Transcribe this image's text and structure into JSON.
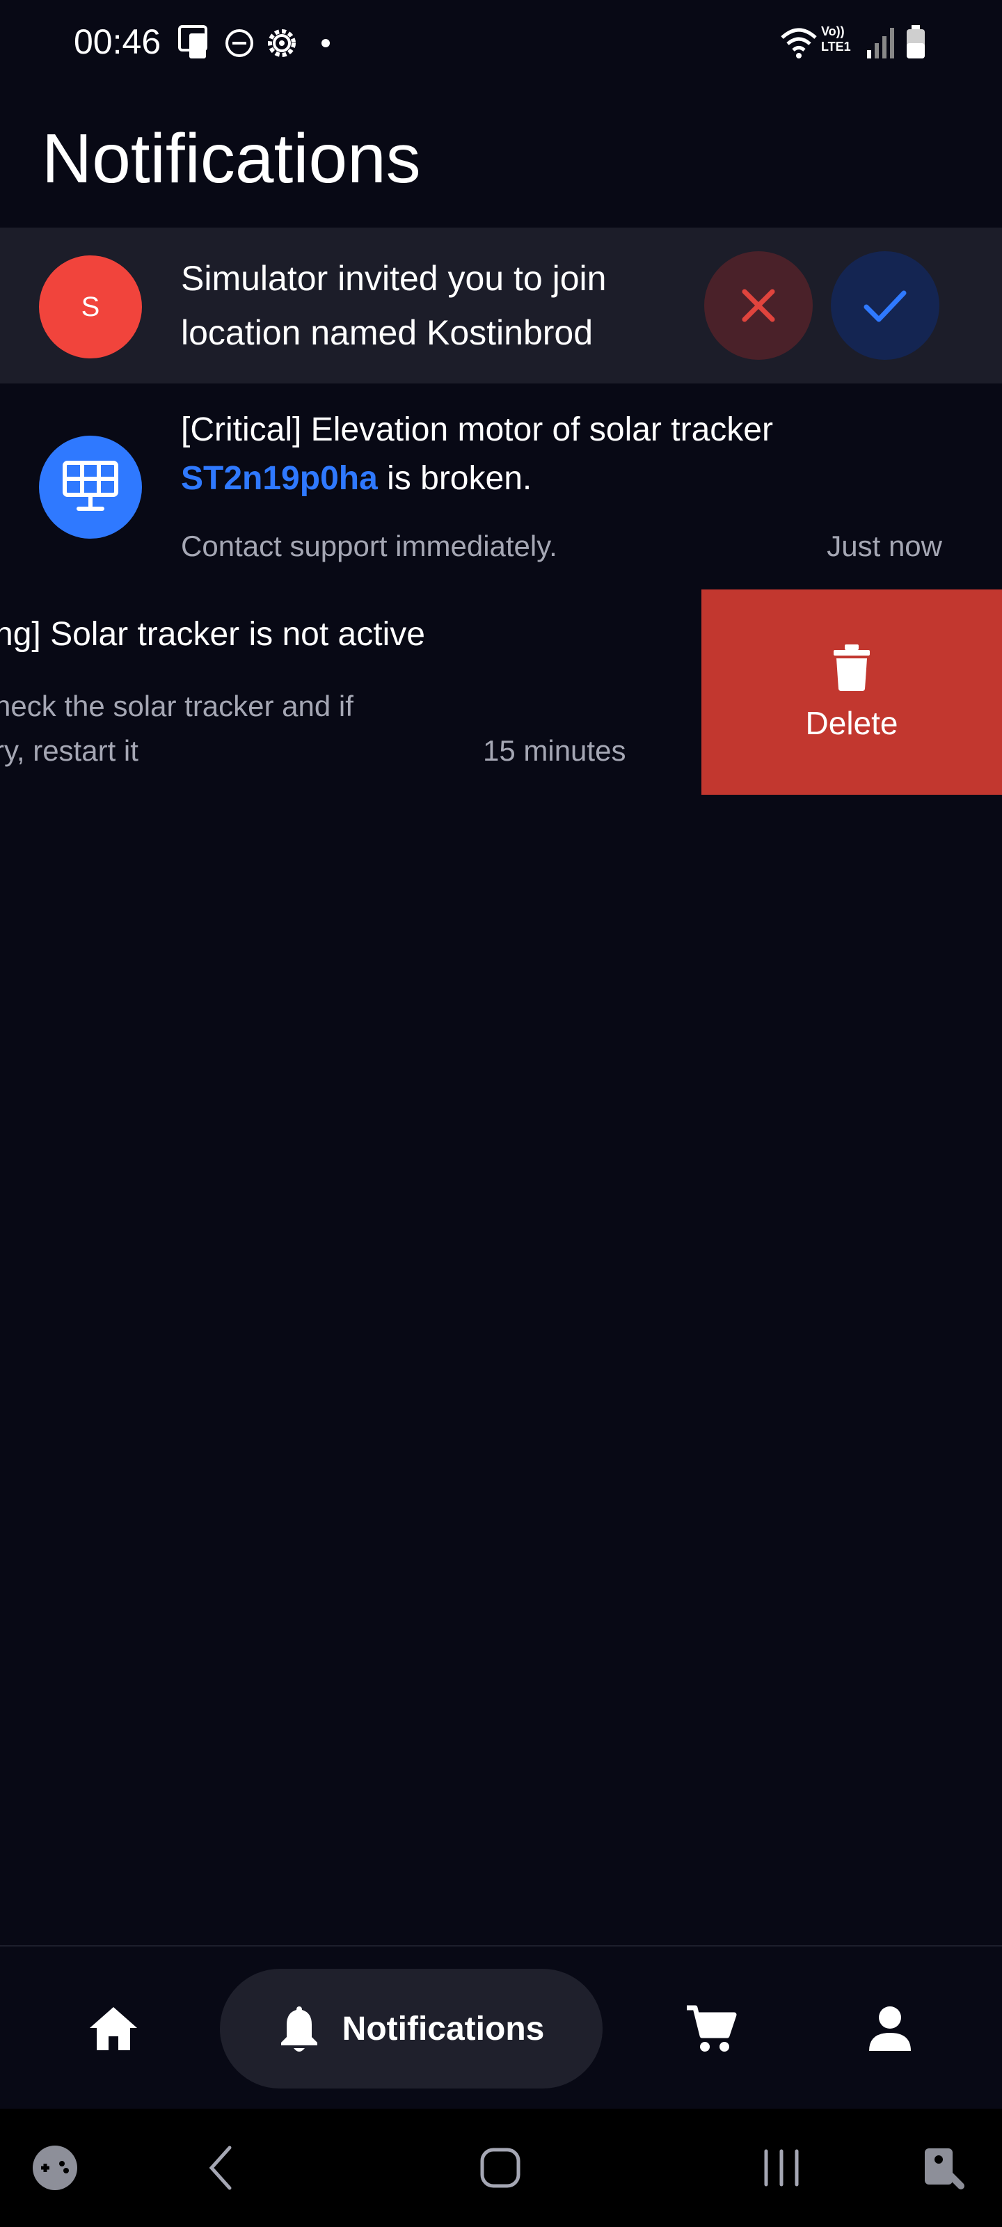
{
  "status_bar": {
    "time": "00:46",
    "left_icons": [
      "sim-card-icon",
      "do-not-disturb-icon",
      "settings-gear-icon",
      "dot-icon"
    ],
    "right_icons": [
      "wifi-icon",
      "volte-lte1-icon",
      "signal-icon",
      "battery-icon"
    ],
    "network_label_1": "Vo))",
    "network_label_2": "LTE1"
  },
  "page": {
    "title": "Notifications"
  },
  "invitation": {
    "avatar_letter": "S",
    "avatar_color": "#f1443c",
    "text": "Simulator invited you to join location named Kostinbrod",
    "decline_icon": "close-icon",
    "accept_icon": "check-icon"
  },
  "notifications": [
    {
      "icon": "solar-panel-icon",
      "icon_bg": "#2f79ff",
      "title_prefix": "[Critical] Elevation motor of solar tracker",
      "device_link": "ST2n19p0ha",
      "title_suffix": " is broken.",
      "description": "Contact support immediately.",
      "time": "Just now"
    },
    {
      "title": "ng] Solar tracker is not active",
      "description_line1": "heck the solar tracker and if",
      "description_line2": "ry, restart it",
      "time": "15 minutes",
      "swipe_action": {
        "label": "Delete",
        "icon": "trash-icon",
        "color": "#c2372f"
      }
    }
  ],
  "bottom_nav": {
    "items": [
      {
        "name": "home",
        "icon": "home-icon"
      },
      {
        "name": "notifications",
        "icon": "bell-icon",
        "label": "Notifications",
        "active": true
      },
      {
        "name": "cart",
        "icon": "cart-icon"
      },
      {
        "name": "profile",
        "icon": "person-icon"
      }
    ]
  },
  "system_nav": {
    "buttons": [
      "game-launcher-icon",
      "back-icon",
      "home-circle-icon",
      "recents-icon",
      "accessibility-icon"
    ]
  },
  "colors": {
    "background": "#080915",
    "accent_blue": "#2f79ff",
    "danger_red": "#c2372f",
    "muted_text": "#a5a7b4"
  }
}
